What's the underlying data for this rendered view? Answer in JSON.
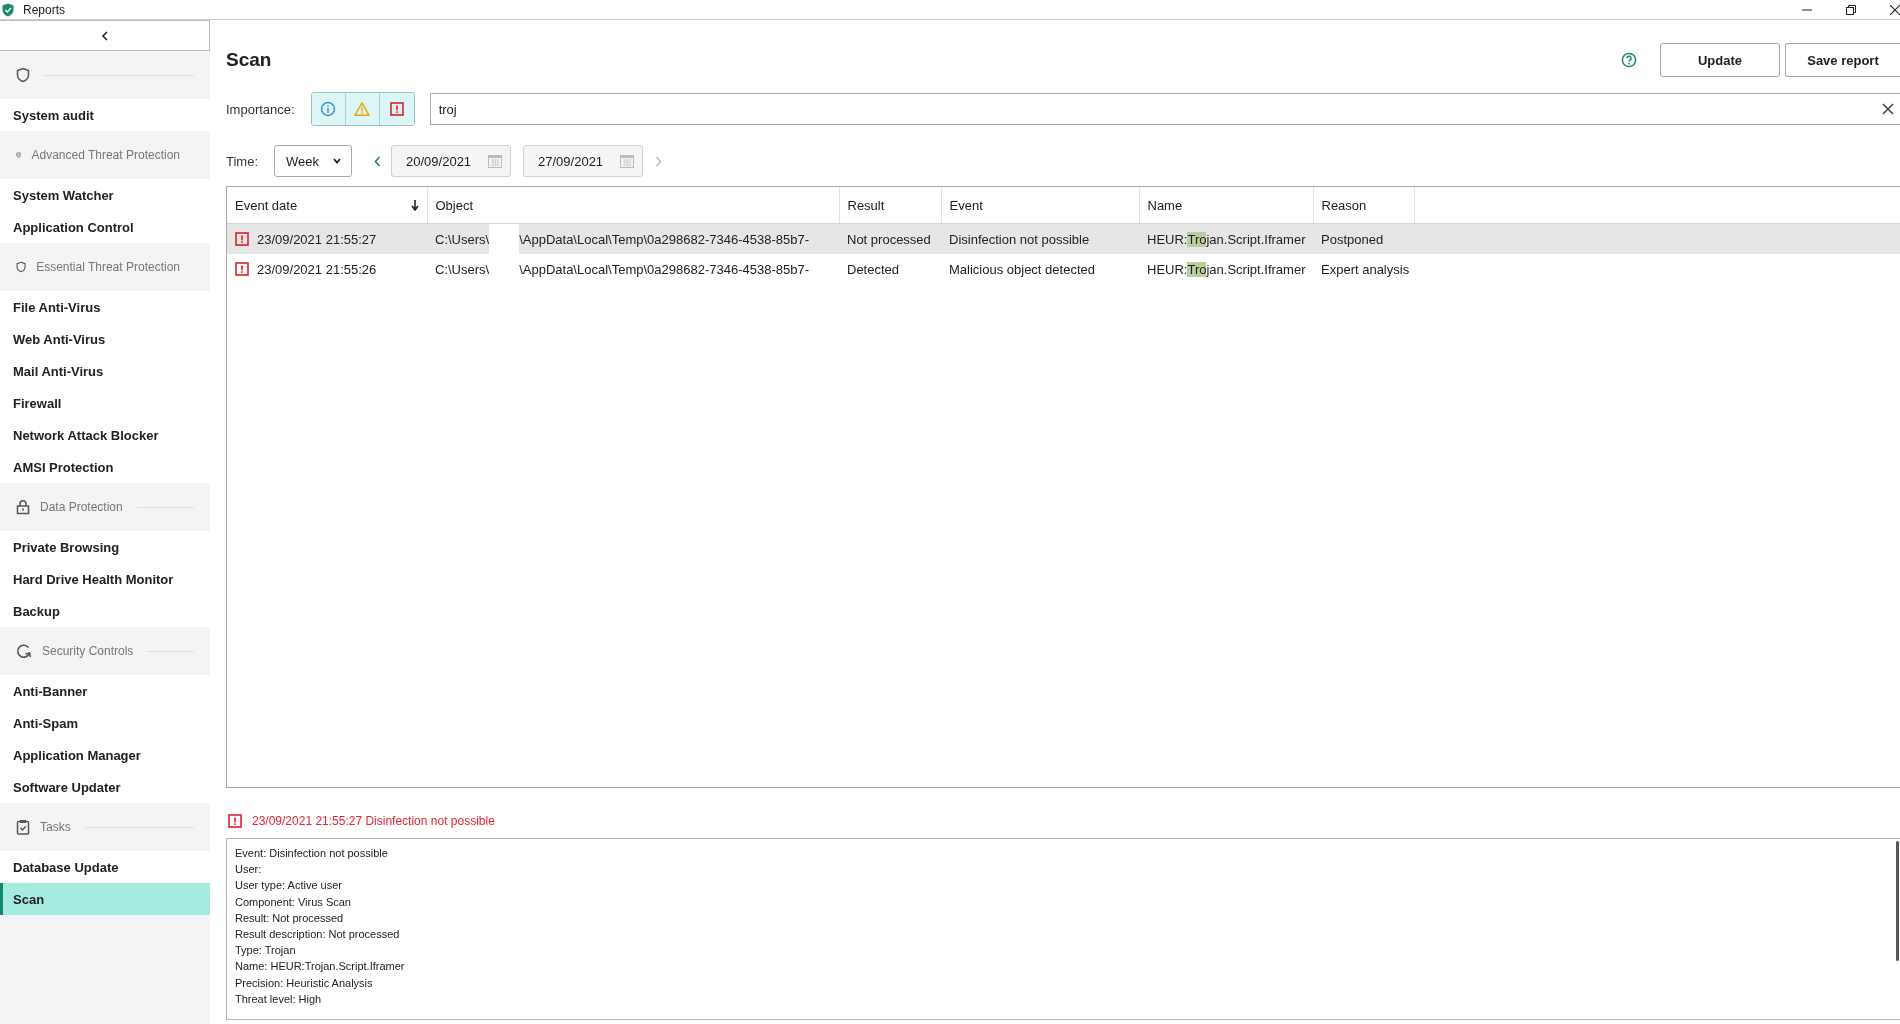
{
  "window": {
    "title": "Reports"
  },
  "sidebar": {
    "groups": [
      {
        "kind": "shield",
        "items": [
          {
            "label": "System audit",
            "selected": false
          }
        ]
      },
      {
        "kind": "shield-badge",
        "label": "Advanced Threat Protection",
        "items": [
          {
            "label": "System Watcher",
            "selected": false
          },
          {
            "label": "Application Control",
            "selected": false
          }
        ]
      },
      {
        "kind": "shield",
        "label": "Essential Threat Protection",
        "items": [
          {
            "label": "File Anti-Virus",
            "selected": false
          },
          {
            "label": "Web Anti-Virus",
            "selected": false
          },
          {
            "label": "Mail Anti-Virus",
            "selected": false
          },
          {
            "label": "Firewall",
            "selected": false
          },
          {
            "label": "Network Attack Blocker",
            "selected": false
          },
          {
            "label": "AMSI Protection",
            "selected": false
          }
        ]
      },
      {
        "kind": "lock",
        "label": "Data Protection",
        "items": [
          {
            "label": "Private Browsing",
            "selected": false
          },
          {
            "label": "Hard Drive Health Monitor",
            "selected": false
          },
          {
            "label": "Backup",
            "selected": false
          }
        ]
      },
      {
        "kind": "refresh",
        "label": "Security Controls",
        "items": [
          {
            "label": "Anti-Banner",
            "selected": false
          },
          {
            "label": "Anti-Spam",
            "selected": false
          },
          {
            "label": "Application Manager",
            "selected": false
          },
          {
            "label": "Software Updater",
            "selected": false
          }
        ]
      },
      {
        "kind": "clipboard",
        "label": "Tasks",
        "items": [
          {
            "label": "Database Update",
            "selected": false
          },
          {
            "label": "Scan",
            "selected": true
          }
        ]
      }
    ]
  },
  "page": {
    "title": "Scan",
    "buttons": [
      "Update",
      "Save report"
    ]
  },
  "filters": {
    "importance_label": "Importance:",
    "importance": [
      {
        "kind": "info",
        "selected": true
      },
      {
        "kind": "warning",
        "selected": true
      },
      {
        "kind": "critical",
        "selected": true
      }
    ],
    "search": {
      "value": "troj"
    },
    "time_label": "Time:",
    "period": "Week",
    "date_from": "20/09/2021",
    "date_to": "27/09/2021",
    "prev_enabled": true,
    "next_enabled": false
  },
  "table": {
    "columns": [
      {
        "label": "Event date",
        "sorted": true
      },
      {
        "label": "Object",
        "sorted": false
      },
      {
        "label": "Result",
        "sorted": false
      },
      {
        "label": "Event",
        "sorted": false
      },
      {
        "label": "Name",
        "sorted": false
      },
      {
        "label": "Reason",
        "sorted": false
      }
    ],
    "rows": [
      {
        "kind": "critical",
        "selected": true,
        "event_date": "23/09/2021 21:55:27",
        "object_start": "C:\\Users\\",
        "object_end": "\\AppData\\Local\\Temp\\0a298682-7346-4538-85b7-",
        "result": "Not processed",
        "event": "Disinfection not possible",
        "name_parts": [
          "HEUR:",
          "Tro",
          "jan.Script.Iframer"
        ],
        "reason": "Postponed"
      },
      {
        "kind": "critical",
        "selected": false,
        "event_date": "23/09/2021 21:55:26",
        "object_start": "C:\\Users\\",
        "object_end": "\\AppData\\Local\\Temp\\0a298682-7346-4538-85b7-",
        "result": "Detected",
        "event": "Malicious object detected",
        "name_parts": [
          "HEUR:",
          "Tro",
          "jan.Script.Iframer"
        ],
        "reason": "Expert analysis"
      }
    ]
  },
  "detail": {
    "kind": "critical",
    "heading": "23/09/2021 21:55:27 Disinfection not possible",
    "lines": [
      "Event: Disinfection not possible",
      "User:",
      "User type: Active user",
      "Component: Virus Scan",
      "Result: Not processed",
      "Result description: Not processed",
      "Type: Trojan",
      "Name: HEUR:Trojan.Script.Iframer",
      "Precision: Heuristic Analysis",
      "Threat level: High"
    ]
  }
}
